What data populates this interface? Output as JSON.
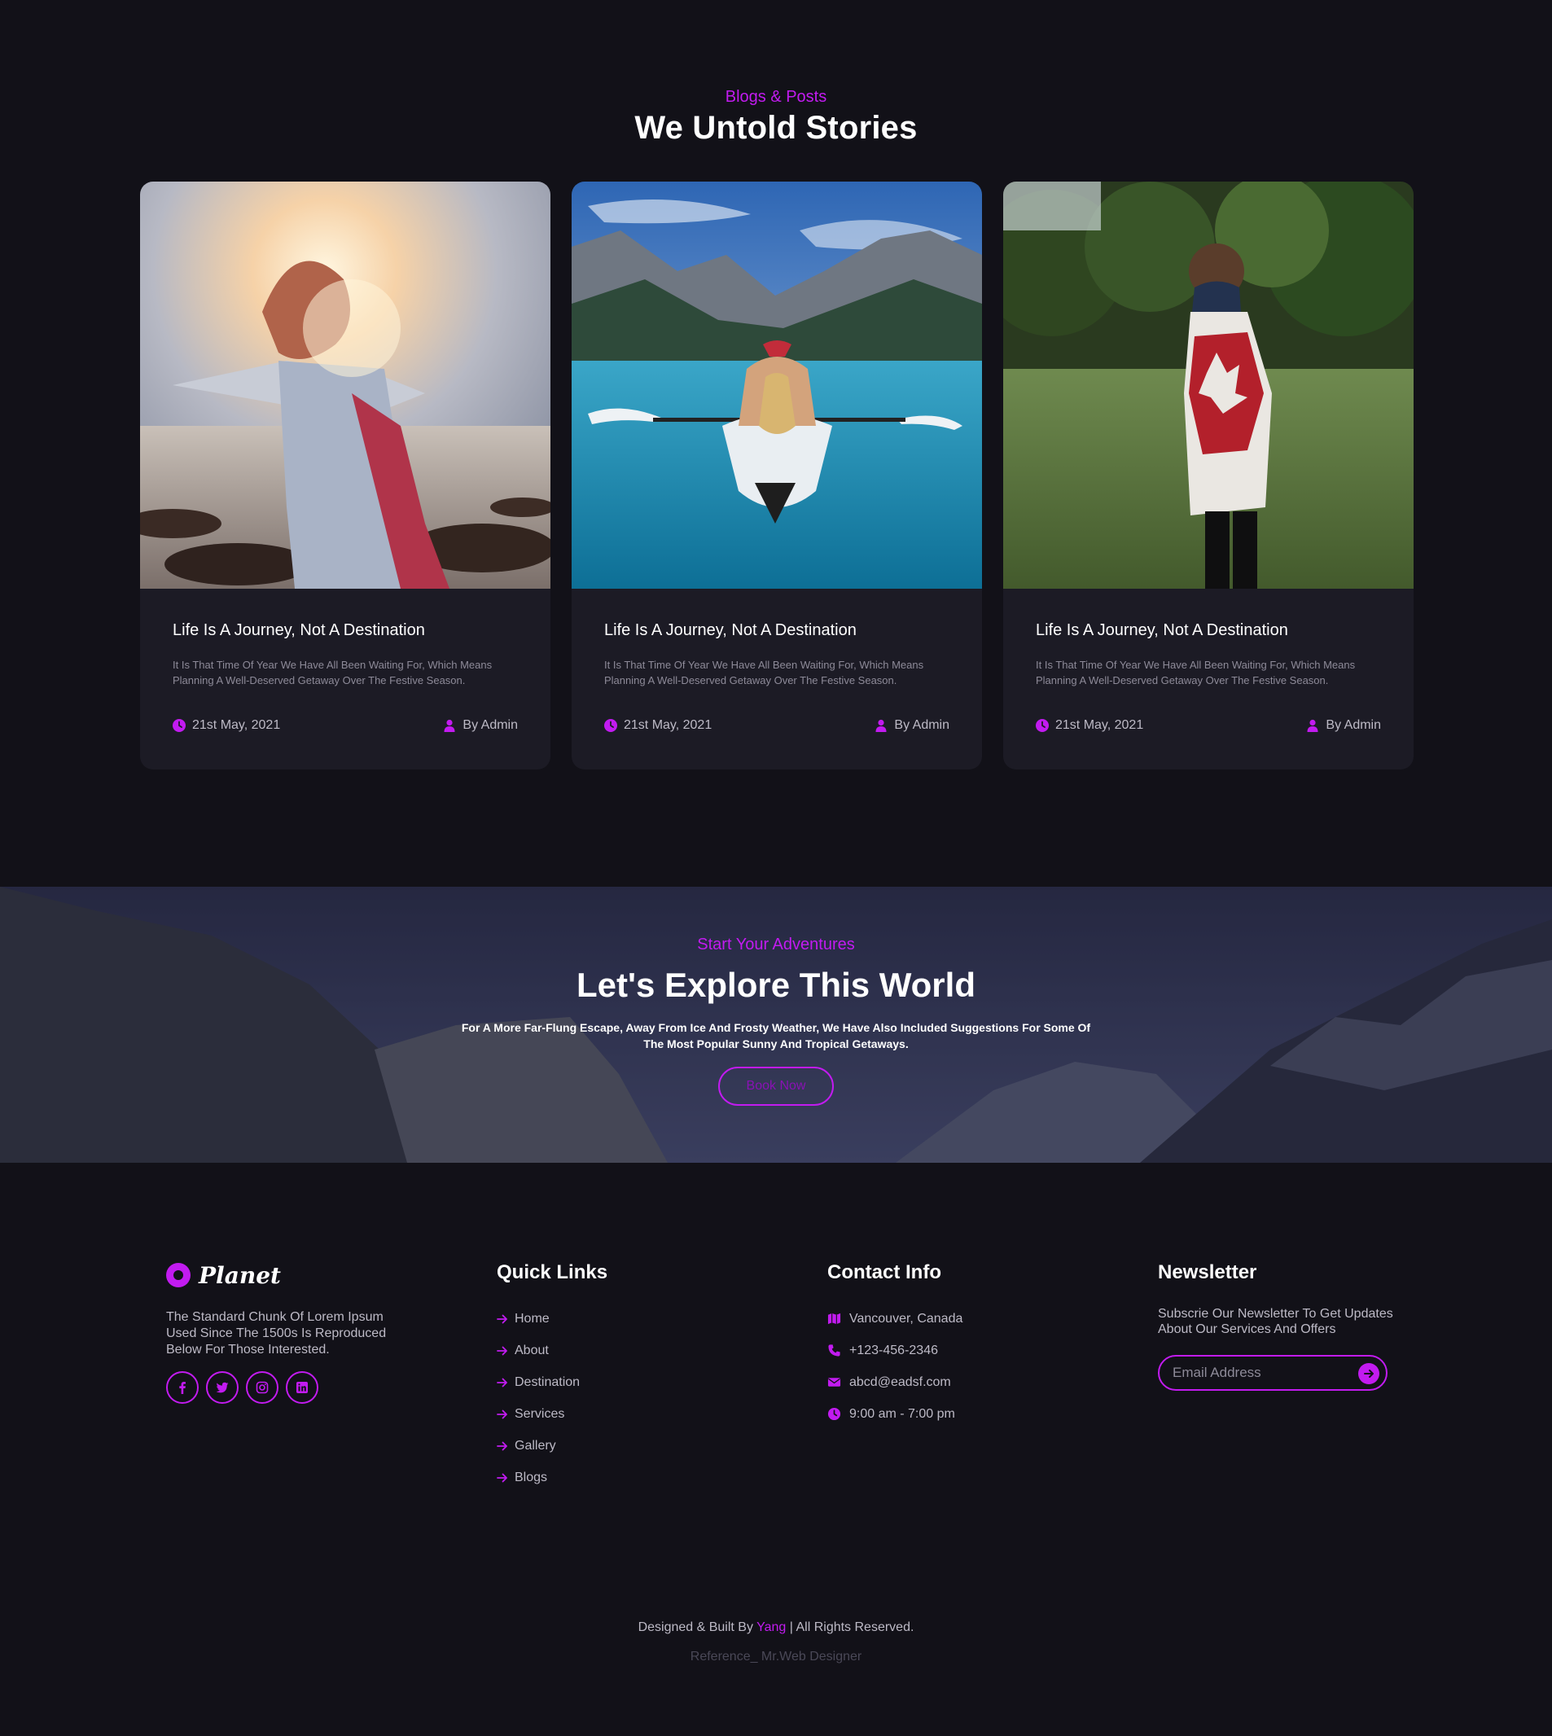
{
  "blogs": {
    "eyebrow": "Blogs & Posts",
    "title": "We Untold Stories",
    "posts": [
      {
        "image": "woman-at-sunset-beach",
        "title": "Life Is A Journey, Not A Destination",
        "excerpt": "It Is That Time Of Year We Have All Been Waiting For, Which Means Planning A Well-Deserved Getaway Over The Festive Season.",
        "date": "21st May, 2021",
        "author": "By Admin"
      },
      {
        "image": "kayaker-on-mountain-lake",
        "title": "Life Is A Journey, Not A Destination",
        "excerpt": "It Is That Time Of Year We Have All Been Waiting For, Which Means Planning A Well-Deserved Getaway Over The Festive Season.",
        "date": "21st May, 2021",
        "author": "By Admin"
      },
      {
        "image": "child-wrapped-in-canada-flag",
        "title": "Life Is A Journey, Not A Destination",
        "excerpt": "It Is That Time Of Year We Have All Been Waiting For, Which Means Planning A Well-Deserved Getaway Over The Festive Season.",
        "date": "21st May, 2021",
        "author": "By Admin"
      }
    ]
  },
  "banner": {
    "eyebrow": "Start Your Adventures",
    "title": "Let's Explore This World",
    "text": "For A More Far-Flung Escape, Away From Ice And Frosty Weather, We Have Also Included Suggestions For Some Of The Most Popular Sunny And Tropical Getaways.",
    "button": "Book Now",
    "image": "snowy-mountain-valley"
  },
  "footer": {
    "brand": {
      "name": "Planet",
      "about": "The Standard Chunk Of Lorem Ipsum Used Since The 1500s Is Reproduced Below For Those Interested.",
      "socials": [
        "facebook-icon",
        "twitter-icon",
        "instagram-icon",
        "linkedin-icon"
      ]
    },
    "quick_links": {
      "title": "Quick Links",
      "items": [
        "Home",
        "About",
        "Destination",
        "Services",
        "Gallery",
        "Blogs"
      ]
    },
    "contact": {
      "title": "Contact Info",
      "address": "Vancouver, Canada",
      "phone": "+123-456-2346",
      "email": "abcd@eadsf.com",
      "hours": "9:00 am - 7:00 pm"
    },
    "newsletter": {
      "title": "Newsletter",
      "text": "Subscrie Our Newsletter To Get Updates About Our Services And Offers",
      "placeholder": "Email Address",
      "value": ""
    },
    "copyright": {
      "prefix": "Designed & Built By ",
      "author": "Yang",
      "suffix": " | All Rights Reserved."
    },
    "reference": "Reference_ Mr.Web Designer"
  },
  "colors": {
    "background": "#121118",
    "card": "#1c1b25",
    "accent": "#c21bf0",
    "muted_text": "#bdbac6"
  }
}
